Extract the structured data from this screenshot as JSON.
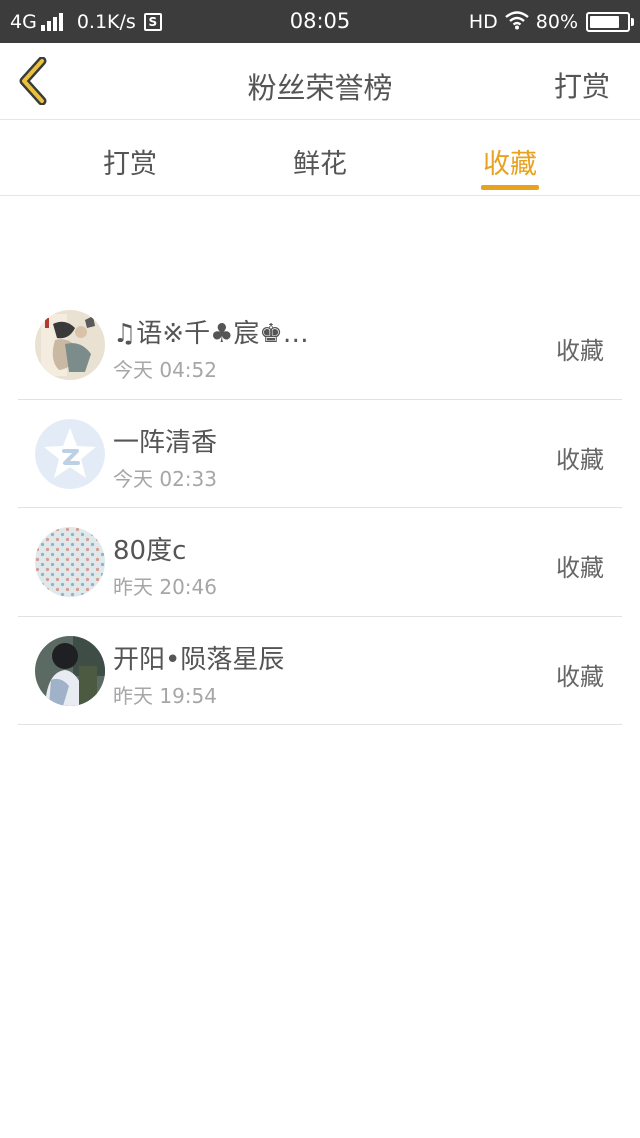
{
  "status_bar": {
    "network": "4G",
    "speed": "0.1K/s",
    "s_badge": "S",
    "time": "08:05",
    "hd": "HD",
    "battery_percent": "80%",
    "battery_level": 0.8
  },
  "header": {
    "title": "粉丝荣誉榜",
    "action_label": "打赏",
    "back_icon": "chevron-left-icon",
    "accent_color": "#e8a21f"
  },
  "tabs": [
    {
      "label": "打赏",
      "active": false
    },
    {
      "label": "鲜花",
      "active": false
    },
    {
      "label": "收藏",
      "active": true
    }
  ],
  "list": [
    {
      "name": "♫语※千♣宸♚…",
      "time": "今天 04:52",
      "action": "收藏",
      "avatar": "artwork-avatar"
    },
    {
      "name": "一阵清香",
      "time": "今天 02:33",
      "action": "收藏",
      "avatar": "default-qzone-avatar"
    },
    {
      "name": "80度c",
      "time": "昨天 20:46",
      "action": "收藏",
      "avatar": "pattern-avatar"
    },
    {
      "name": "开阳•陨落星辰",
      "time": "昨天 19:54",
      "action": "收藏",
      "avatar": "photo-avatar"
    }
  ]
}
